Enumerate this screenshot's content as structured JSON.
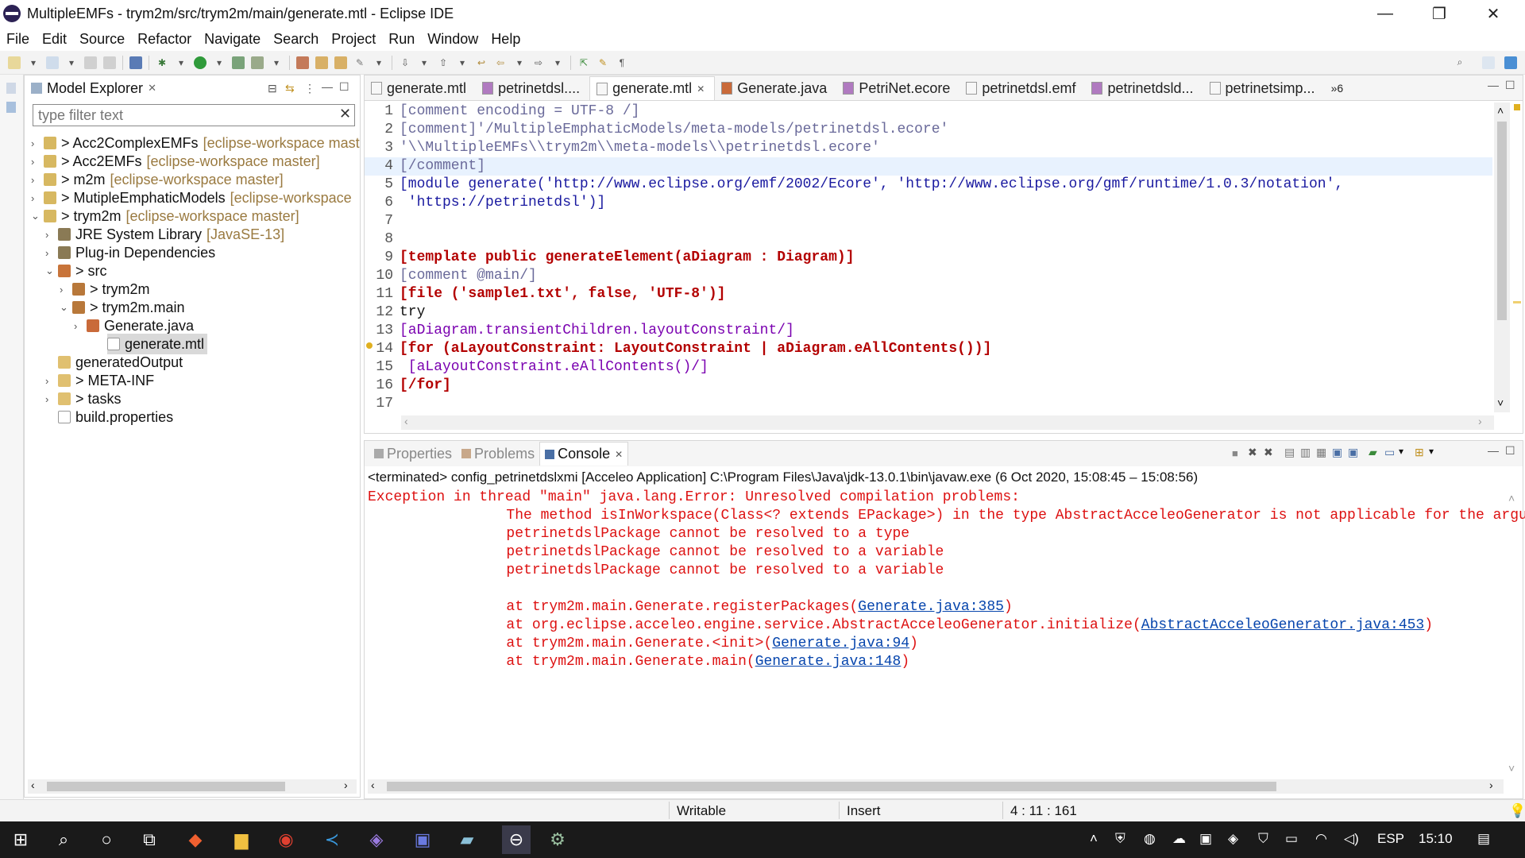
{
  "window": {
    "title": "MultipleEMFs - trym2m/src/trym2m/main/generate.mtl - Eclipse IDE",
    "controls": [
      "—",
      "❐",
      "✕"
    ]
  },
  "menu": [
    "File",
    "Edit",
    "Source",
    "Refactor",
    "Navigate",
    "Search",
    "Project",
    "Run",
    "Window",
    "Help"
  ],
  "explorer": {
    "title": "Model Explorer",
    "filter_placeholder": "type filter text",
    "tree": [
      {
        "label": "> Acc2ComplexEMFs",
        "deco": "[eclipse-workspace mast"
      },
      {
        "label": "> Acc2EMFs",
        "deco": "[eclipse-workspace master]"
      },
      {
        "label": "> m2m",
        "deco": "[eclipse-workspace master]"
      },
      {
        "label": "> MutipleEmphaticModels",
        "deco": "[eclipse-workspace"
      },
      {
        "label": "> trym2m",
        "deco": "[eclipse-workspace master]"
      },
      {
        "label": "JRE System Library",
        "deco": "[JavaSE-13]"
      },
      {
        "label": "Plug-in Dependencies",
        "deco": ""
      },
      {
        "label": "> src",
        "deco": ""
      },
      {
        "label": "> trym2m",
        "deco": ""
      },
      {
        "label": "> trym2m.main",
        "deco": ""
      },
      {
        "label": "Generate.java",
        "deco": ""
      },
      {
        "label": "generate.mtl",
        "deco": ""
      },
      {
        "label": "generatedOutput",
        "deco": ""
      },
      {
        "label": "> META-INF",
        "deco": ""
      },
      {
        "label": "> tasks",
        "deco": ""
      },
      {
        "label": "build.properties",
        "deco": ""
      }
    ]
  },
  "editor": {
    "tabs": [
      "generate.mtl",
      "petrinetdsl....",
      "generate.mtl",
      "Generate.java",
      "PetriNet.ecore",
      "petrinetdsl.emf",
      "petrinetdsld...",
      "petrinetsimp..."
    ],
    "overflow": "»6",
    "line_numbers": [
      "1",
      "2",
      "3",
      "4",
      "5",
      "6",
      "7",
      "8",
      "9",
      "10",
      "11",
      "12",
      "13",
      "14",
      "15",
      "16",
      "17"
    ],
    "lines": [
      "[comment encoding = UTF-8 /]",
      "[comment]'/MultipleEmphaticModels/meta-models/petrinetdsl.ecore'",
      "'\\\\MultipleEMFs\\\\trym2m\\\\meta-models\\\\petrinetdsl.ecore'",
      "[/comment]",
      "[module generate('http://www.eclipse.org/emf/2002/Ecore', 'http://www.eclipse.org/gmf/runtime/1.0.3/notation',",
      " 'https://petrinetdsl')]",
      "",
      "",
      "[template public generateElement(aDiagram : Diagram)]",
      "[comment @main/]",
      "[file ('sample1.txt', false, 'UTF-8')]",
      "try",
      "[aDiagram.transientChildren.layoutConstraint/]",
      "[for (aLayoutConstraint: LayoutConstraint | aDiagram.eAllContents())]",
      " [aLayoutConstraint.eAllContents()/]",
      "[/for]",
      ""
    ]
  },
  "bottom_panel": {
    "tabs": [
      "Properties",
      "Problems",
      "Console"
    ],
    "terminated": "<terminated> config_petrinetdslxmi [Acceleo Application] C:\\Program Files\\Java\\jdk-13.0.1\\bin\\javaw.exe  (6 Oct 2020, 15:08:45 – 15:08:56)",
    "output": [
      "Exception in thread \"main\" java.lang.Error: Unresolved compilation problems: ",
      "\tThe method isInWorkspace(Class<? extends EPackage>) in the type AbstractAcceleoGenerator is not applicable for the argumen",
      "\tpetrinetdslPackage cannot be resolved to a type",
      "\tpetrinetdslPackage cannot be resolved to a variable",
      "\tpetrinetdslPackage cannot be resolved to a variable",
      ""
    ],
    "stack": [
      {
        "prefix": "\tat trym2m.main.Generate.registerPackages(",
        "link": "Generate.java:385",
        "suffix": ")"
      },
      {
        "prefix": "\tat org.eclipse.acceleo.engine.service.AbstractAcceleoGenerator.initialize(",
        "link": "AbstractAcceleoGenerator.java:453",
        "suffix": ")"
      },
      {
        "prefix": "\tat trym2m.main.Generate.<init>(",
        "link": "Generate.java:94",
        "suffix": ")"
      },
      {
        "prefix": "\tat trym2m.main.Generate.main(",
        "link": "Generate.java:148",
        "suffix": ")"
      }
    ]
  },
  "status": {
    "writable": "Writable",
    "insert": "Insert",
    "position": "4 : 11 : 161"
  },
  "taskbar": {
    "language": "ESP",
    "time": "15:10"
  },
  "colors": {
    "keyword": "#b30000",
    "error": "#dd1111",
    "link": "#0645ad"
  }
}
